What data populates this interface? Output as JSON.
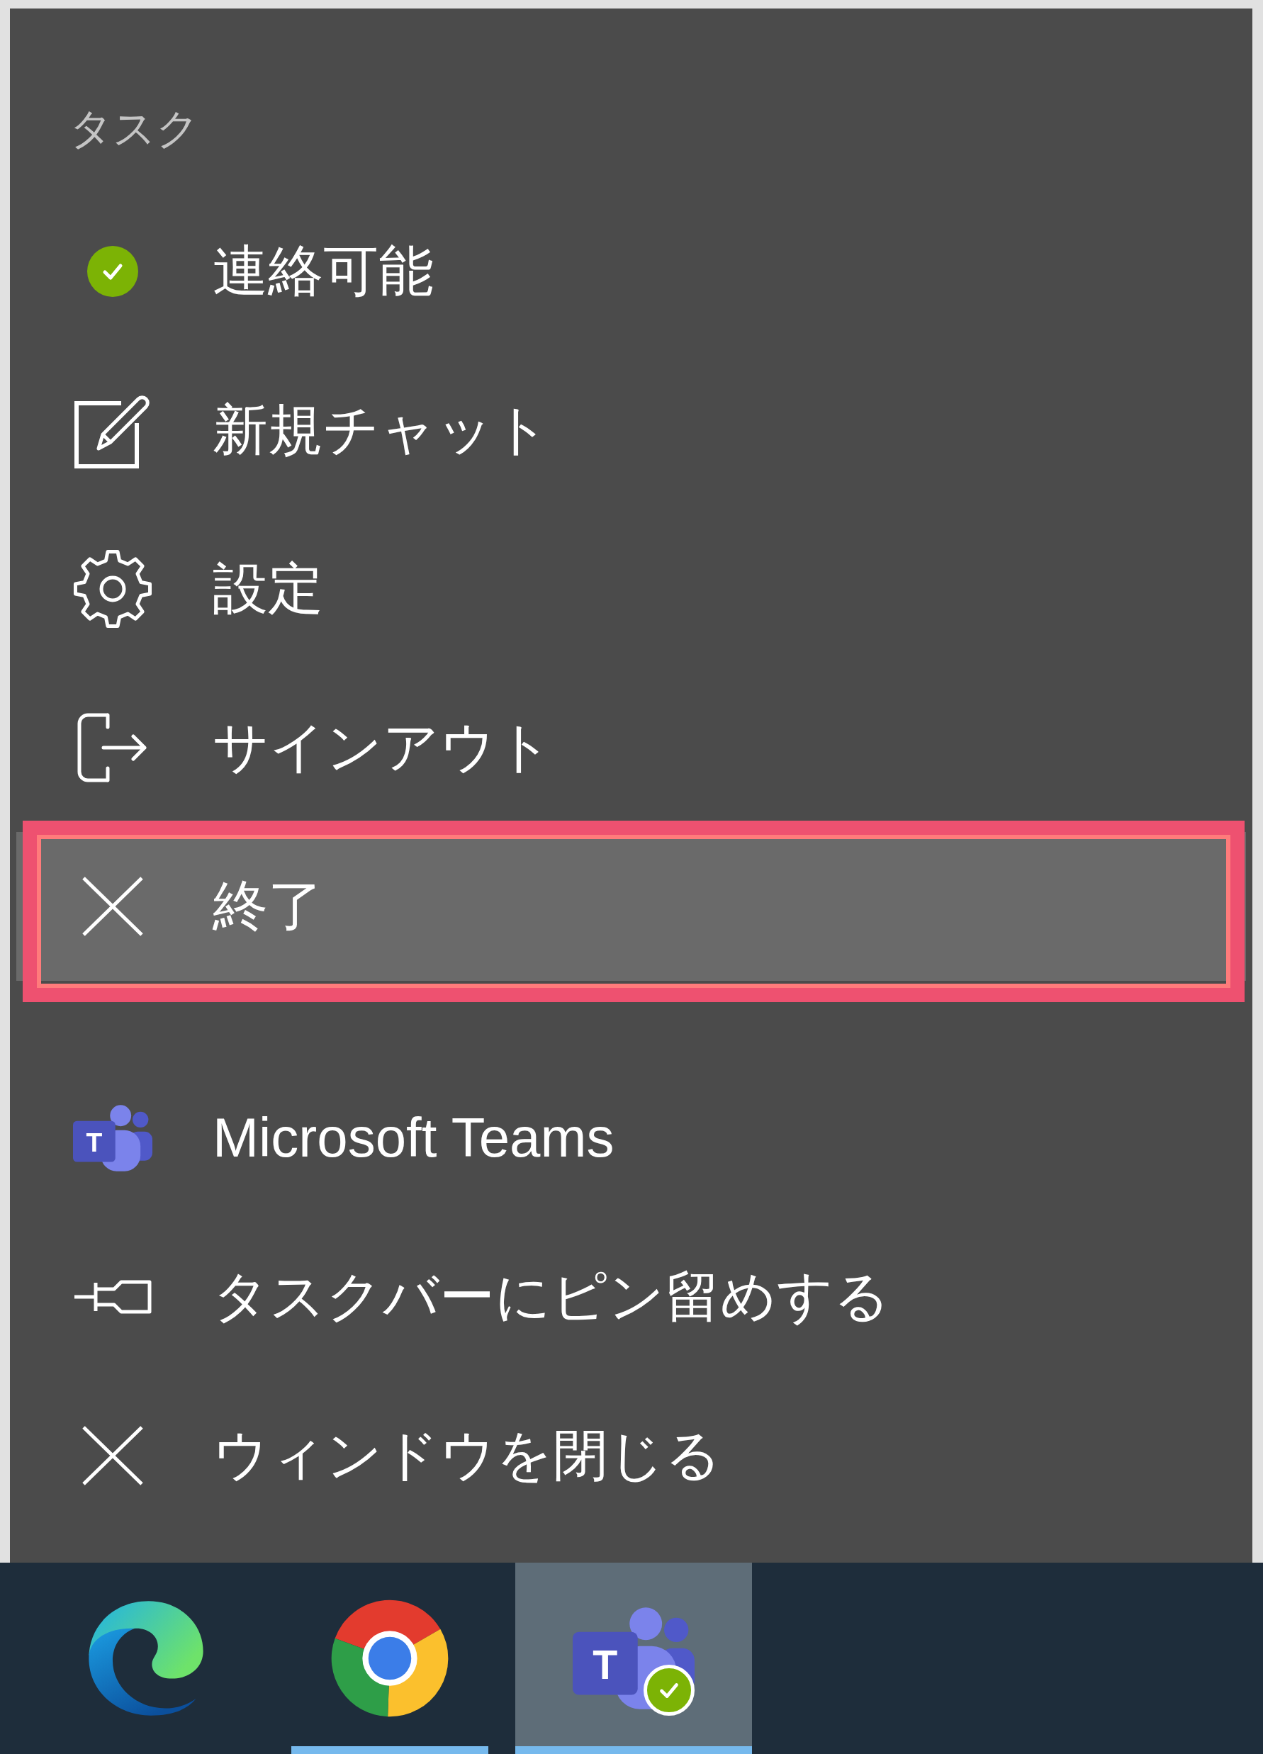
{
  "jump_list": {
    "sections": [
      {
        "heading": "タスク",
        "items": [
          {
            "kind": "status",
            "label": "連絡可能",
            "color": "#7cb305",
            "selected": false,
            "outlined": false
          },
          {
            "kind": "compose",
            "label": "新規チャット",
            "selected": false,
            "outlined": false
          },
          {
            "kind": "settings",
            "label": "設定",
            "selected": false,
            "outlined": false
          },
          {
            "kind": "sign-out",
            "label": "サインアウト",
            "selected": false,
            "outlined": false
          },
          {
            "kind": "quit",
            "label": "終了",
            "selected": true,
            "outlined": true
          }
        ]
      },
      {
        "items": [
          {
            "kind": "app",
            "icon_letter": "T",
            "label": "Microsoft Teams",
            "selected": false,
            "outlined": false
          },
          {
            "kind": "pin",
            "label": "タスクバーにピン留めする",
            "selected": false,
            "outlined": false
          },
          {
            "kind": "close",
            "label": "ウィンドウを閉じる",
            "selected": false,
            "outlined": false
          }
        ]
      }
    ]
  },
  "taskbar": {
    "apps": [
      {
        "kind": "swirl",
        "running": false,
        "selected": false,
        "badge": false
      },
      {
        "kind": "ring",
        "running": true,
        "selected": false,
        "badge": false
      },
      {
        "kind": "people",
        "icon_letter": "T",
        "running": true,
        "selected": true,
        "badge": true
      }
    ]
  }
}
